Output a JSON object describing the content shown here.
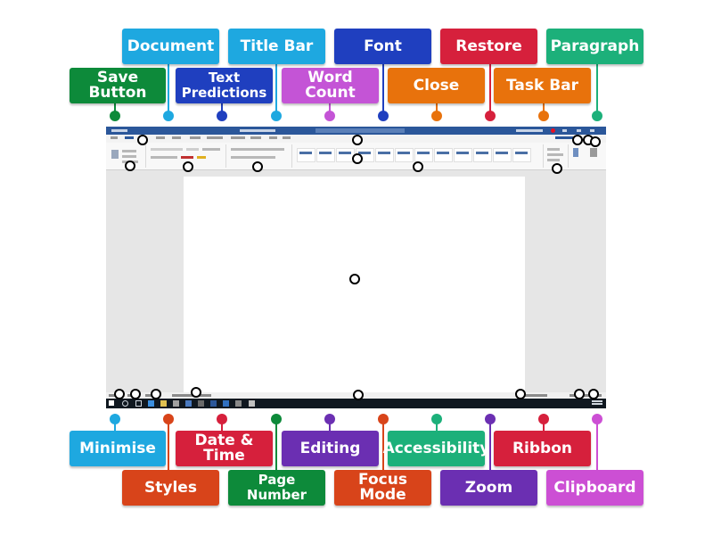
{
  "colors": {
    "green": "#0d8a3a",
    "cyan": "#1ea8e0",
    "navy": "#1f3fbf",
    "orchid": "#c454d6",
    "orange": "#e8720c",
    "crimson": "#d6203c",
    "teal": "#1cb07a",
    "rust": "#d8441a",
    "purple": "#6b2fb2",
    "magenta": "#cc4fd4",
    "pin_stroke": "#000000"
  },
  "labels": {
    "save_button": "Save Button",
    "document": "Document",
    "text_predictions_l1": "Text",
    "text_predictions_l2": "Predictions",
    "title_bar": "Title Bar",
    "word_count": "Word Count",
    "font": "Font",
    "close": "Close",
    "restore": "Restore",
    "task_bar": "Task Bar",
    "paragraph": "Paragraph",
    "minimise": "Minimise",
    "styles": "Styles",
    "date_time": "Date & Time",
    "page_number_l1": "Page",
    "page_number_l2": "Number",
    "editing": "Editing",
    "focus_mode": "Focus Mode",
    "accessibility": "Accessibility",
    "zoom": "Zoom",
    "ribbon": "Ribbon",
    "clipboard": "Clipboard"
  },
  "screenshot": {
    "description_icon": "word-window-icon",
    "style_gallery": [
      "AaBbCcDd",
      "AaBbCcDd",
      "AaBbC",
      "AaBbC",
      "AaB",
      "AaBbCcD",
      "AaBbCcDd",
      "AaBbCcDd",
      "AaBbCcD",
      "AaBbCcDd",
      "AaBbCcDd",
      "AaBbCcDd"
    ]
  }
}
